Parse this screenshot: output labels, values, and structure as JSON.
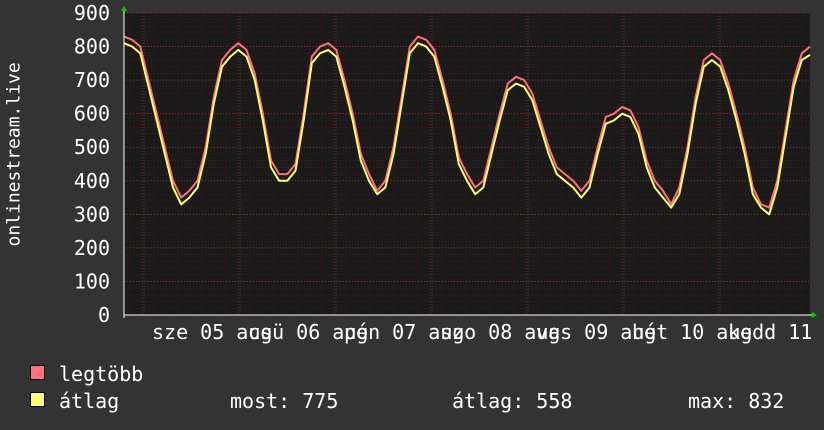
{
  "chart_data": {
    "type": "line",
    "ylabel": "onlinestream.live",
    "ylim": [
      0,
      900
    ],
    "yticks": [
      "0",
      "100",
      "200",
      "300",
      "400",
      "500",
      "600",
      "700",
      "800",
      "900"
    ],
    "xtick_labels": [
      "sze 05 aug",
      "csü 06 aug",
      "pén 07 aug",
      "szo 08 aug",
      "vas 09 aug",
      "hét 10 aug",
      "kedd 11 aug"
    ],
    "grid": true,
    "colors": {
      "background": "#333333",
      "plot_bg": "#1a1a1a",
      "grid": "#7a2020",
      "legtobb": "#ff7079",
      "atlag": "#ffff70",
      "axis": "#ffffff",
      "arrow": "#00cc00"
    },
    "series": [
      {
        "name": "legtöbb",
        "color": "#ff7079",
        "values": [
          830,
          820,
          800,
          700,
          600,
          500,
          400,
          350,
          370,
          400,
          500,
          650,
          760,
          790,
          810,
          790,
          720,
          600,
          460,
          420,
          420,
          450,
          600,
          770,
          800,
          810,
          790,
          700,
          600,
          480,
          420,
          370,
          400,
          500,
          650,
          800,
          830,
          820,
          790,
          700,
          600,
          470,
          420,
          380,
          400,
          500,
          600,
          690,
          710,
          700,
          660,
          580,
          500,
          440,
          420,
          400,
          370,
          400,
          500,
          590,
          600,
          620,
          610,
          560,
          460,
          400,
          370,
          330,
          380,
          500,
          650,
          760,
          780,
          760,
          690,
          600,
          500,
          380,
          330,
          320,
          400,
          550,
          700,
          780,
          800
        ]
      },
      {
        "name": "átlag",
        "color": "#ffff70",
        "values": [
          810,
          800,
          780,
          680,
          580,
          480,
          380,
          330,
          350,
          380,
          480,
          630,
          740,
          770,
          790,
          770,
          700,
          580,
          440,
          400,
          400,
          430,
          580,
          750,
          780,
          790,
          770,
          680,
          580,
          460,
          400,
          360,
          380,
          480,
          630,
          780,
          810,
          800,
          770,
          680,
          580,
          450,
          400,
          360,
          380,
          480,
          580,
          670,
          690,
          680,
          640,
          560,
          480,
          420,
          400,
          380,
          350,
          380,
          480,
          570,
          580,
          600,
          590,
          540,
          440,
          380,
          350,
          320,
          360,
          480,
          630,
          740,
          760,
          740,
          670,
          580,
          480,
          360,
          320,
          300,
          380,
          530,
          680,
          760,
          775
        ]
      }
    ]
  },
  "legend": {
    "items": [
      {
        "label": "legtöbb",
        "color": "#ff7079"
      },
      {
        "label": "átlag",
        "color": "#ffff70"
      }
    ],
    "now": "most: 775",
    "avg": "átlag: 558",
    "max": "max: 832"
  }
}
